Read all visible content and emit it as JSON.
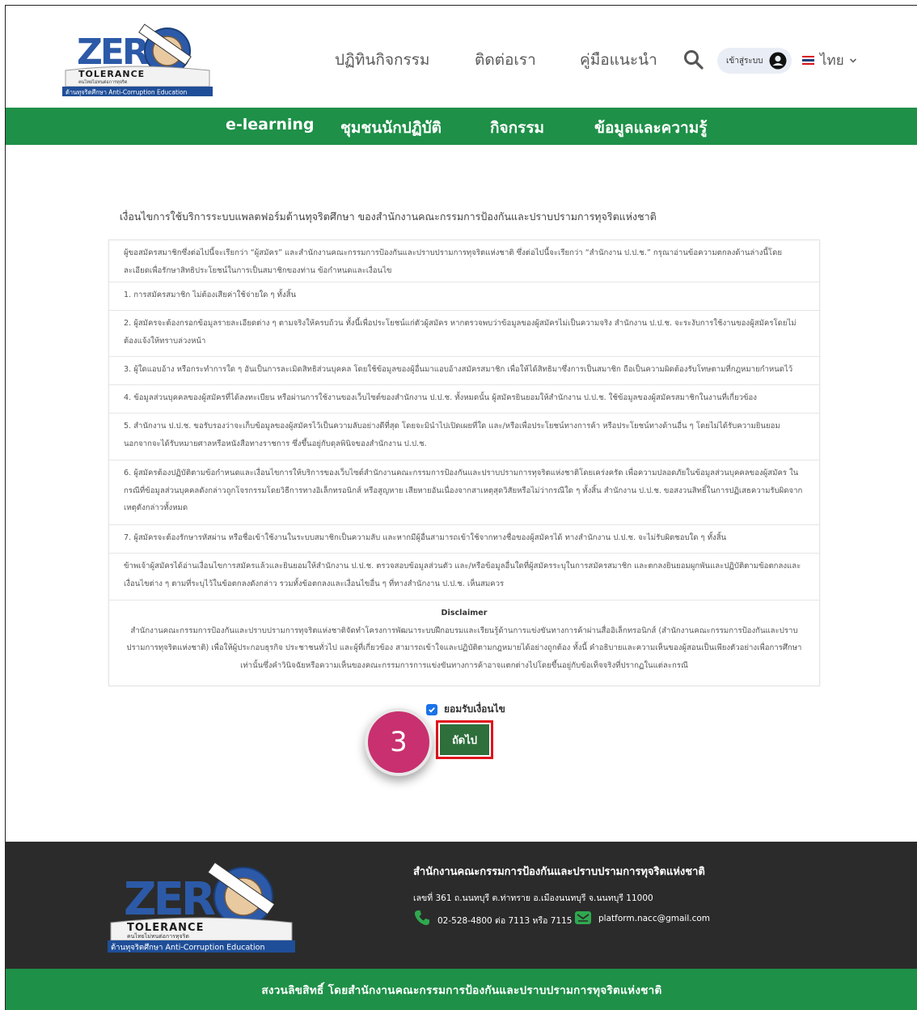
{
  "header": {
    "logo_text": "ZERO TOLERANCE",
    "logo_sub": "คนไทยไม่ทนต่อการทุจริต",
    "logo_banner": "ต้านทุจริตศึกษา Anti-Corruption Education",
    "nav": [
      "ปฏิทินกิจกรรม",
      "ติดต่อเรา",
      "คู่มือแนะนำ"
    ],
    "login_label": "เข้าสู่ระบบ",
    "lang_label": "ไทย"
  },
  "menu": [
    "e-learning",
    "ชุมชนนักปฏิบัติ",
    "กิจกรรม",
    "ข้อมูลและความรู้"
  ],
  "terms": {
    "title": "เงื่อนไขการใช้บริการระบบแพลตฟอร์มต้านทุจริตศึกษา ของสำนักงานคณะกรรมการป้องกันและปราบปรามการทุจริตแห่งชาติ",
    "intro": "ผู้ขอสมัครสมาชิกซึ่งต่อไปนี้จะเรียกว่า “ผู้สมัคร” และสำนักงานคณะกรรมการป้องกันและปราบปรามการทุจริตแห่งชาติ ซึ่งต่อไปนี้จะเรียกว่า “สำนักงาน ป.ป.ช.” กรุณาอ่านข้อความตกลงด้านล่างนี้โดยละเอียดเพื่อรักษาสิทธิประโยชน์ในการเป็นสมาชิกของท่าน ข้อกำหนดและเงื่อนไข",
    "items": [
      "1. การสมัครสมาชิก ไม่ต้องเสียค่าใช้จ่ายใด ๆ ทั้งสิ้น",
      "2. ผู้สมัครจะต้องกรอกข้อมูลรายละเอียดต่าง ๆ ตามจริงให้ครบถ้วน ทั้งนี้เพื่อประโยชน์แก่ตัวผู้สมัคร หากตรวจพบว่าข้อมูลของผู้สมัครไม่เป็นความจริง สำนักงาน ป.ป.ช. จะระงับการใช้งานของผู้สมัครโดยไม่ต้องแจ้งให้ทราบล่วงหน้า",
      "3. ผู้ใดแอบอ้าง หรือกระทำการใด ๆ อันเป็นการละเมิดสิทธิส่วนบุคคล โดยใช้ข้อมูลของผู้อื่นมาแอบอ้างสมัครสมาชิก เพื่อให้ได้สิทธิมาซึ่งการเป็นสมาชิก ถือเป็นความผิดต้องรับโทษตามที่กฎหมายกำหนดไว้",
      "4. ข้อมูลส่วนบุคคลของผู้สมัครที่ได้ลงทะเบียน หรือผ่านการใช้งานของเว็บไซต์ของสำนักงาน ป.ป.ช. ทั้งหมดนั้น ผู้สมัครยินยอมให้สำนักงาน ป.ป.ช. ใช้ข้อมูลของผู้สมัครสมาชิกในงานที่เกี่ยวข้อง",
      "5. สำนักงาน ป.ป.ช. ขอรับรองว่าจะเก็บข้อมูลของผู้สมัครไว้เป็นความลับอย่างดีที่สุด โดยจะมินำไปเปิดเผยที่ใด และ/หรือเพื่อประโยชน์ทางการค้า หรือประโยชน์ทางด้านอื่น ๆ โดยไม่ได้รับความยินยอม นอกจากจะได้รับหมายศาลหรือหนังสือทางราชการ ซึ่งขึ้นอยู่กับดุลพินิจของสำนักงาน ป.ป.ช.",
      "6. ผู้สมัครต้องปฏิบัติตามข้อกำหนดและเงื่อนไขการให้บริการของเว็บไซต์สำนักงานคณะกรรมการป้องกันและปราบปรามการทุจริตแห่งชาติโดยเคร่งครัด เพื่อความปลอดภัยในข้อมูลส่วนบุคคลของผู้สมัคร ในกรณีที่ข้อมูลส่วนบุคคลดังกล่าวถูกโจรกรรมโดยวิธีการทางอิเล็กทรอนิกส์ หรือสูญหาย เสียหายอันเนื่องจากสาเหตุสุดวิสัยหรือไม่ว่ากรณีใด ๆ ทั้งสิ้น สำนักงาน ป.ป.ช. ขอสงวนสิทธิ์ในการปฏิเสธความรับผิดจาก เหตุดังกล่าวทั้งหมด",
      "7. ผู้สมัครจะต้องรักษารหัสผ่าน หรือชื่อเข้าใช้งานในระบบสมาชิกเป็นความลับ และหากมีผู้อื่นสามารถเข้าใช้จากทางชื่อของผู้สมัครได้ ทางสำนักงาน ป.ป.ช. จะไม่รับผิดชอบใด ๆ ทั้งสิ้น"
    ],
    "closing": "ข้าพเจ้าผู้สมัครได้อ่านเงื่อนไขการสมัครแล้วและยินยอมให้สำนักงาน ป.ป.ช. ตรวจสอบข้อมูลส่วนตัว และ/หรือข้อมูลอื่นใดที่ผู้สมัครระบุในการสมัครสมาชิก และตกลงยินยอมผูกพันและปฏิบัติตามข้อตกลงและเงื่อนไขต่าง ๆ ตามที่ระบุไว้ในข้อตกลงดังกล่าว รวมทั้งข้อตกลงและเงื่อนไขอื่น ๆ ที่ทางสำนักงาน ป.ป.ช. เห็นสมควร",
    "disclaimer_title": "Disclaimer",
    "disclaimer_body": "สำนักงานคณะกรรมการป้องกันและปราบปรามการทุจริตแห่งชาติจัดทำโครงการพัฒนาระบบฝึกอบรมและเรียนรู้ด้านการแข่งขันทางการค้าผ่านสื่ออิเล็กทรอนิกส์ (สำนักงานคณะกรรมการป้องกันและปราบปรามการทุจริตแห่งชาติ) เพื่อให้ผู้ประกอบธุรกิจ ประชาชนทั่วไป และผู้ที่เกี่ยวข้อง สามารถเข้าใจและปฏิบัติตามกฎหมายได้อย่างถูกต้อง ทั้งนี้ คำอธิบายและความเห็นของผู้สอนเป็นเพียงตัวอย่างเพื่อการศึกษาเท่านั้นซึ่งคำวินิจฉัยหรือความเห็นของคณะกรรมการการแข่งขันทางการค้าอาจแตกต่างไปโดยขึ้นอยู่กับข้อเท็จจริงที่ปรากฏในแต่ละกรณี"
  },
  "agree_label": "ยอมรับเงื่อนไข",
  "next_label": "ถัดไป",
  "step_number": "3",
  "footer": {
    "org": "สำนักงานคณะกรรมการป้องกันและปราบปรามการทุจริตแห่งชาติ",
    "address": "เลขที่ 361 ถ.นนทบุรี ต.ท่าทราย อ.เมืองนนทบุรี จ.นนทบุรี 11000",
    "phone": "02-528-4800 ต่อ 7113 หรือ 7115",
    "email": "platform.nacc@gmail.com",
    "copyright": "สงวนลิขสิทธิ์ โดยสำนักงานคณะกรรมการป้องกันและปราบปรามการทุจริตแห่งชาติ"
  },
  "colors": {
    "green": "#1e9048",
    "dark": "#2b2b2b",
    "button": "#2e6f3c",
    "highlight": "#e0141d",
    "badge": "#c8306f"
  }
}
